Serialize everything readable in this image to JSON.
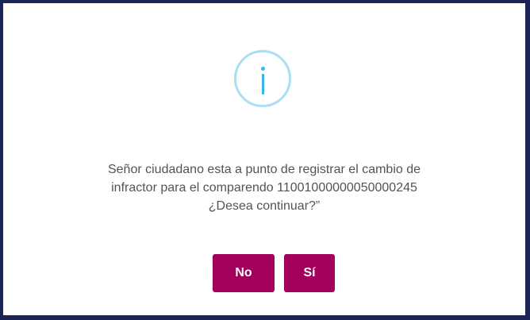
{
  "dialog": {
    "icon": "info-icon",
    "message_lines": [
      "Señor ciudadano esta a punto de registrar el cambio de",
      "infractor para el comparendo 11001000000050000245",
      "¿Desea continuar?”"
    ],
    "buttons": {
      "no_label": "No",
      "yes_label": "Sí"
    }
  },
  "colors": {
    "frame": "#1a2456",
    "button": "#a3005d",
    "icon_ring": "#a9def5",
    "icon_glyph": "#3fb4ea"
  }
}
